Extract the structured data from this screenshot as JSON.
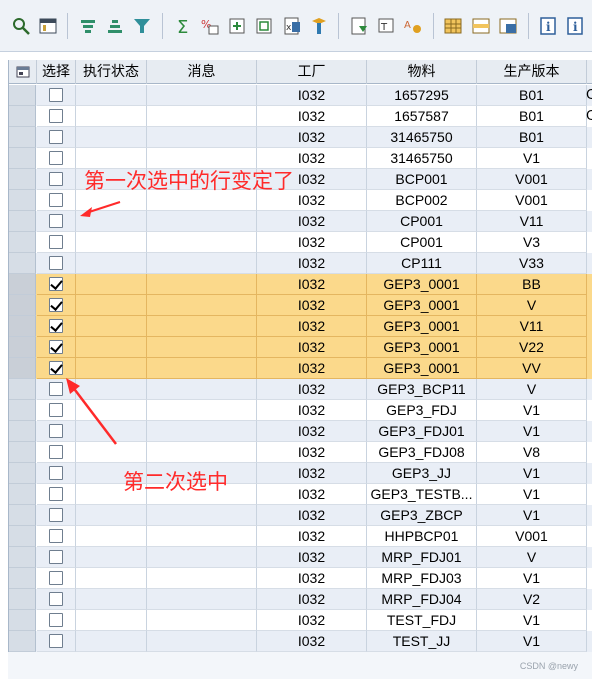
{
  "toolbar": {
    "icons": [
      "details-icon",
      "print-preview-icon",
      "sort-ascending-icon",
      "sort-descending-icon",
      "filter-icon",
      "total-icon",
      "subtotal-icon",
      "export-icon",
      "layout-icon",
      "excel-icon",
      "word-icon",
      "spreadsheet-icon",
      "send-icon",
      "abc-analysis-icon",
      "grid-view-icon",
      "change-layout-icon",
      "select-layout-icon",
      "info-icon",
      "help-info-icon"
    ]
  },
  "table": {
    "columns": [
      "选择",
      "执行状态",
      "消息",
      "工厂",
      "物料",
      "生产版本"
    ],
    "rows": [
      {
        "checked": false,
        "plant": "I032",
        "material": "1657295",
        "version": "B01",
        "tail": "C"
      },
      {
        "checked": false,
        "plant": "I032",
        "material": "1657587",
        "version": "B01",
        "tail": "C"
      },
      {
        "checked": false,
        "plant": "I032",
        "material": "31465750",
        "version": "B01",
        "tail": ""
      },
      {
        "checked": false,
        "plant": "I032",
        "material": "31465750",
        "version": "V1",
        "tail": ""
      },
      {
        "checked": false,
        "plant": "I032",
        "material": "BCP001",
        "version": "V001",
        "tail": ""
      },
      {
        "checked": false,
        "plant": "I032",
        "material": "BCP002",
        "version": "V001",
        "tail": ""
      },
      {
        "checked": false,
        "plant": "I032",
        "material": "CP001",
        "version": "V11",
        "tail": ""
      },
      {
        "checked": false,
        "plant": "I032",
        "material": "CP001",
        "version": "V3",
        "tail": ""
      },
      {
        "checked": false,
        "plant": "I032",
        "material": "CP111",
        "version": "V33",
        "tail": ""
      },
      {
        "checked": true,
        "plant": "I032",
        "material": "GEP3_0001",
        "version": "BB",
        "tail": ""
      },
      {
        "checked": true,
        "plant": "I032",
        "material": "GEP3_0001",
        "version": "V",
        "tail": ""
      },
      {
        "checked": true,
        "plant": "I032",
        "material": "GEP3_0001",
        "version": "V11",
        "tail": ""
      },
      {
        "checked": true,
        "plant": "I032",
        "material": "GEP3_0001",
        "version": "V22",
        "tail": ""
      },
      {
        "checked": true,
        "plant": "I032",
        "material": "GEP3_0001",
        "version": "VV",
        "tail": ""
      },
      {
        "checked": false,
        "plant": "I032",
        "material": "GEP3_BCP11",
        "version": "V",
        "tail": ""
      },
      {
        "checked": false,
        "plant": "I032",
        "material": "GEP3_FDJ",
        "version": "V1",
        "tail": ""
      },
      {
        "checked": false,
        "plant": "I032",
        "material": "GEP3_FDJ01",
        "version": "V1",
        "tail": ""
      },
      {
        "checked": false,
        "plant": "I032",
        "material": "GEP3_FDJ08",
        "version": "V8",
        "tail": ""
      },
      {
        "checked": false,
        "plant": "I032",
        "material": "GEP3_JJ",
        "version": "V1",
        "tail": ""
      },
      {
        "checked": false,
        "plant": "I032",
        "material": "GEP3_TESTB...",
        "version": "V1",
        "tail": ""
      },
      {
        "checked": false,
        "plant": "I032",
        "material": "GEP3_ZBCP",
        "version": "V1",
        "tail": ""
      },
      {
        "checked": false,
        "plant": "I032",
        "material": "HHPBCP01",
        "version": "V001",
        "tail": ""
      },
      {
        "checked": false,
        "plant": "I032",
        "material": "MRP_FDJ01",
        "version": "V",
        "tail": ""
      },
      {
        "checked": false,
        "plant": "I032",
        "material": "MRP_FDJ03",
        "version": "V1",
        "tail": ""
      },
      {
        "checked": false,
        "plant": "I032",
        "material": "MRP_FDJ04",
        "version": "V2",
        "tail": ""
      },
      {
        "checked": false,
        "plant": "I032",
        "material": "TEST_FDJ",
        "version": "V1",
        "tail": ""
      },
      {
        "checked": false,
        "plant": "I032",
        "material": "TEST_JJ",
        "version": "V1",
        "tail": ""
      }
    ]
  },
  "annotations": {
    "first": "第一次选中的行变定了",
    "second": "第二次选中",
    "color": "#ff2a2a"
  },
  "watermark": "CSDN @newy",
  "colors": {
    "selected_row": "#fbd98b",
    "alt_row": "#e9eef6",
    "header": "#e7ecf2"
  }
}
